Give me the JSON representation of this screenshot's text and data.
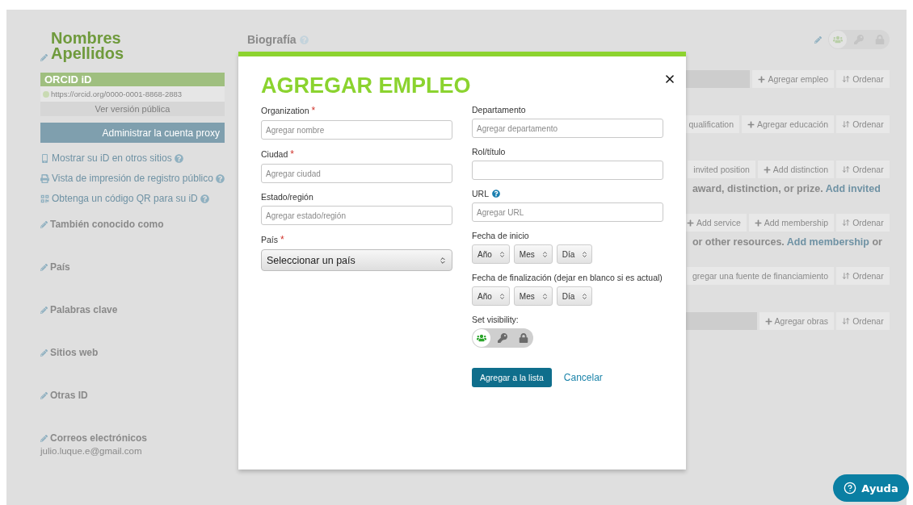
{
  "sidebar": {
    "name_lines": [
      "Nombres",
      "Apellidos"
    ],
    "orcid": {
      "header": "ORCID iD",
      "url": "https://orcid.org/0000-0001-8868-2883",
      "public_link": "Ver versión pública"
    },
    "proxy_button": "Administrar la cuenta proxy",
    "links": [
      {
        "kind": "phone",
        "label": "Mostrar su iD en otros sitios"
      },
      {
        "kind": "print",
        "label": "Vista de impresión de registro público"
      },
      {
        "kind": "qr",
        "label": "Obtenga un código QR para su iD"
      }
    ],
    "sections": [
      {
        "title": "También conocido como"
      },
      {
        "title": "País"
      },
      {
        "title": "Palabras clave"
      },
      {
        "title": "Sitios web"
      },
      {
        "title": "Otras ID"
      },
      {
        "title": "Correos electrónicos",
        "value": "julio.luque.e@gmail.com"
      }
    ]
  },
  "main": {
    "heading": "Biografía",
    "visibility": [
      {
        "kind": "everyone",
        "selected": true
      },
      {
        "kind": "trusted",
        "selected": false
      },
      {
        "kind": "private",
        "selected": false
      }
    ],
    "rows": [
      {
        "kind": "toolbar",
        "bar": true,
        "buttons": [
          {
            "label": "Agregar empleo",
            "kind": "add"
          },
          {
            "label": "Ordenar",
            "kind": "sort"
          }
        ]
      },
      {
        "kind": "toolbar",
        "bar": false,
        "buttons": [
          {
            "label": "qualification",
            "kind": "plain"
          },
          {
            "label": "Agregar educación",
            "kind": "add"
          },
          {
            "label": "Ordenar",
            "kind": "sort"
          }
        ]
      },
      {
        "kind": "toolbar",
        "bar": false,
        "buttons": [
          {
            "label": "invited position",
            "kind": "plain"
          },
          {
            "label": "Add distinction",
            "kind": "add"
          },
          {
            "label": "Ordenar",
            "kind": "sort"
          }
        ]
      },
      {
        "kind": "text",
        "text": "award, distinction, or prize.",
        "link": "Add invited"
      },
      {
        "kind": "toolbar",
        "bar": false,
        "buttons": [
          {
            "label": "Add service",
            "kind": "add"
          },
          {
            "label": "Add membership",
            "kind": "add"
          },
          {
            "label": "Ordenar",
            "kind": "sort"
          }
        ]
      },
      {
        "kind": "text",
        "text": "or other resources.",
        "link": "Add membership",
        "after": "or"
      },
      {
        "kind": "toolbar",
        "bar": false,
        "buttons": [
          {
            "label": "gregar una fuente de financiamiento",
            "kind": "plain"
          },
          {
            "label": "Ordenar",
            "kind": "sort"
          }
        ]
      },
      {
        "kind": "toolbar",
        "bar": true,
        "buttons": [
          {
            "label": "Agregar obras",
            "kind": "add"
          },
          {
            "label": "Ordenar",
            "kind": "sort"
          }
        ]
      }
    ]
  },
  "modal": {
    "title": "AGREGAR EMPLEO",
    "columns": [
      [
        {
          "kind": "text",
          "label": "Organization",
          "required_mark": "*",
          "placeholder": "Agregar nombre"
        },
        {
          "kind": "text",
          "label": "Ciudad",
          "required_mark": "*",
          "placeholder": "Agregar ciudad"
        },
        {
          "kind": "text",
          "label": "Estado/región",
          "placeholder": "Agregar estado/región"
        },
        {
          "kind": "select",
          "label": "País",
          "required_mark": "*",
          "value": "Seleccionar un país"
        }
      ],
      [
        {
          "kind": "text",
          "label": "Departamento",
          "placeholder": "Agregar departamento"
        },
        {
          "kind": "text",
          "label": "Rol/título"
        },
        {
          "kind": "text",
          "label": "URL",
          "help": true,
          "placeholder": "Agregar URL"
        },
        {
          "kind": "date",
          "label": "Fecha de inicio",
          "parts": [
            "Año",
            "Mes",
            "Día"
          ]
        },
        {
          "kind": "date",
          "label": "Fecha de finalización (dejar en blanco si es actual)",
          "parts": [
            "Año",
            "Mes",
            "Día"
          ]
        }
      ]
    ],
    "visibility_label": "Set visibility:",
    "visibility": [
      {
        "kind": "everyone",
        "selected": true
      },
      {
        "kind": "trusted",
        "selected": false
      },
      {
        "kind": "private",
        "selected": false
      }
    ],
    "submit": "Agregar a la lista",
    "cancel": "Cancelar"
  },
  "help_button": "Ayuda"
}
